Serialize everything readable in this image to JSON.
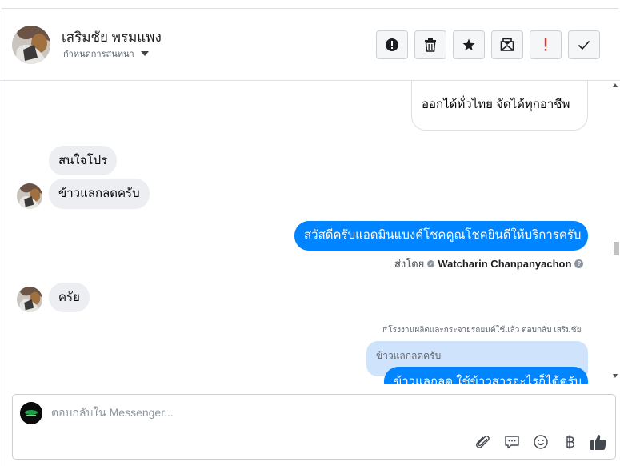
{
  "header": {
    "contact_name": "เสริมชัย พรมแพง",
    "conversation_settings_label": "กำหนดการสนทนา",
    "actions": [
      {
        "name": "report-spam-button",
        "icon": "exclamation-circle-icon"
      },
      {
        "name": "delete-button",
        "icon": "trash-icon"
      },
      {
        "name": "star-button",
        "icon": "star-icon"
      },
      {
        "name": "mark-unread-button",
        "icon": "envelope-icon"
      },
      {
        "name": "mark-important-button",
        "icon": "exclamation-icon"
      },
      {
        "name": "mark-done-button",
        "icon": "checkmark-icon"
      }
    ]
  },
  "messages": {
    "m1": "ออกได้ทั่วไทย จัดได้ทุกอาชีพ",
    "m2": "สนใจโปร",
    "m3": "ข้าวแลกลดครับ",
    "m4": "สวัสดีครับแอดมินแบงค์โชคคูณโชคยินดีให้บริการครับ",
    "sent_by_label": "ส่งโดย",
    "sent_by_name": "Watcharin Chanpanyachon",
    "m5": "ครัย",
    "reply_note": "โรงงานผลิตและกระจายรถยนต์ใช้แล้ว ตอบกลับ เสริมชัย",
    "quoted_text": "ข้าวแลกลดครับ",
    "m6": "ข้าวแลกลด ใช้ข้าวสารอะไรก็ได้ครับ"
  },
  "composer": {
    "placeholder": "ตอบกลับใน Messenger...",
    "tools": [
      "paperclip-icon",
      "quick-replies-icon",
      "emoji-icon",
      "baht-payment-icon",
      "thumbs-up-icon"
    ]
  },
  "colors": {
    "accent": "#0084ff",
    "incoming_bubble": "#eceef1",
    "quoted_bubble": "#cfe3fc"
  }
}
